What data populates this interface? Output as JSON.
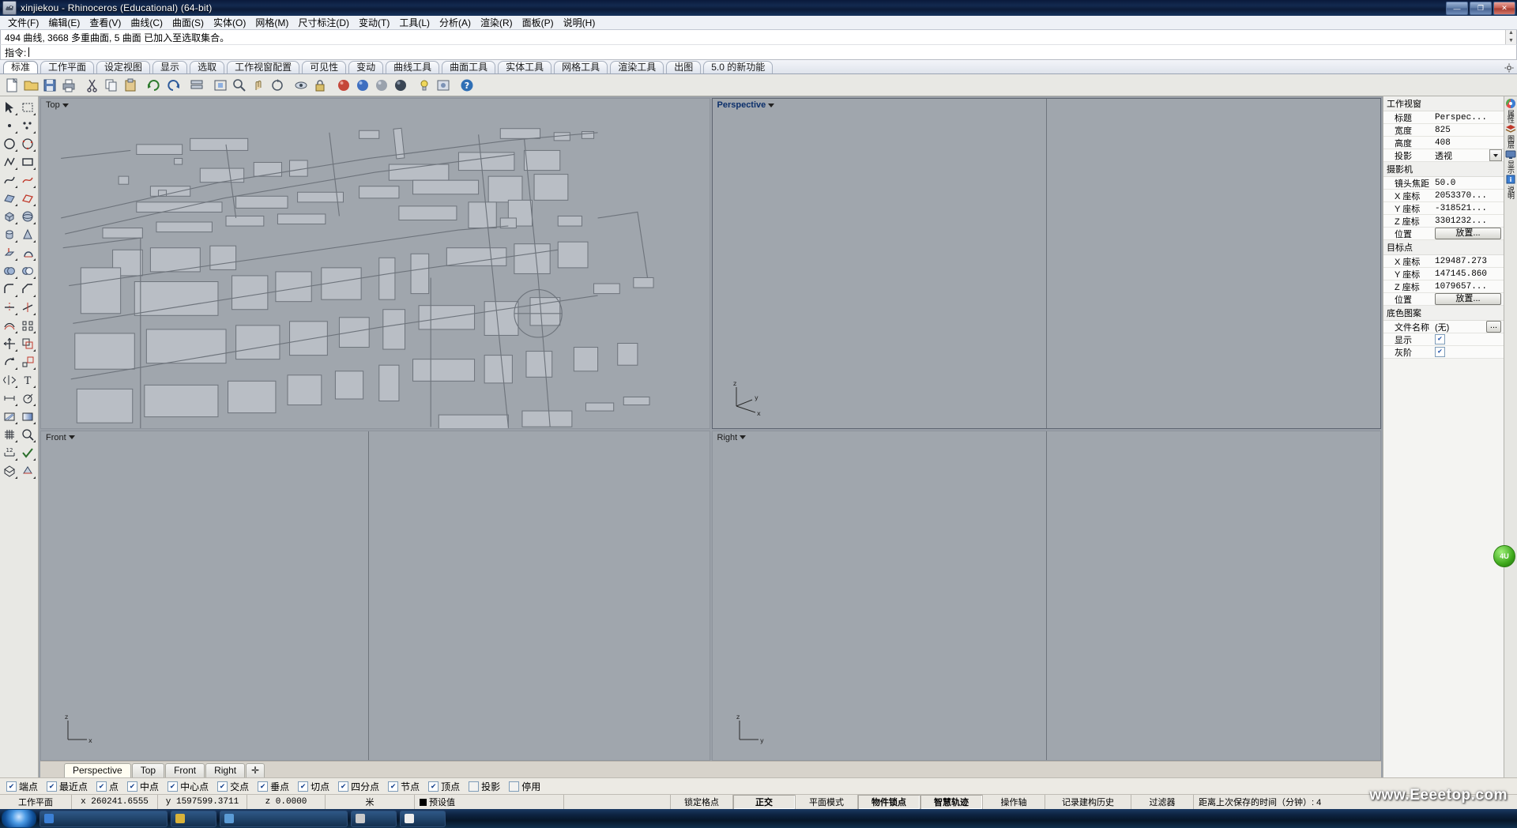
{
  "window": {
    "title": "xinjiekou - Rhinoceros (Educational) (64-bit)",
    "app_icon": "rhino-icon",
    "minimize": "—",
    "maximize": "❐",
    "close": "✕"
  },
  "menu": {
    "items": [
      {
        "label": "文件(F)",
        "name": "menu-file"
      },
      {
        "label": "编辑(E)",
        "name": "menu-edit"
      },
      {
        "label": "查看(V)",
        "name": "menu-view"
      },
      {
        "label": "曲线(C)",
        "name": "menu-curve"
      },
      {
        "label": "曲面(S)",
        "name": "menu-surface"
      },
      {
        "label": "实体(O)",
        "name": "menu-solid"
      },
      {
        "label": "网格(M)",
        "name": "menu-mesh"
      },
      {
        "label": "尺寸标注(D)",
        "name": "menu-dimension"
      },
      {
        "label": "变动(T)",
        "name": "menu-transform"
      },
      {
        "label": "工具(L)",
        "name": "menu-tools"
      },
      {
        "label": "分析(A)",
        "name": "menu-analyze"
      },
      {
        "label": "渲染(R)",
        "name": "menu-render"
      },
      {
        "label": "面板(P)",
        "name": "menu-panels"
      },
      {
        "label": "说明(H)",
        "name": "menu-help"
      }
    ]
  },
  "command": {
    "history": "494 曲线, 3668 多重曲面, 5 曲面 已加入至选取集合。",
    "prompt_label": "指令:",
    "input_value": "",
    "input_placeholder": ""
  },
  "toolbar_tabs": {
    "active": "标准",
    "items": [
      {
        "label": "标准",
        "name": "tab-standard"
      },
      {
        "label": "工作平面",
        "name": "tab-cplane"
      },
      {
        "label": "设定视图",
        "name": "tab-set-view"
      },
      {
        "label": "显示",
        "name": "tab-display"
      },
      {
        "label": "选取",
        "name": "tab-select"
      },
      {
        "label": "工作视窗配置",
        "name": "tab-viewport-layout"
      },
      {
        "label": "可见性",
        "name": "tab-visibility"
      },
      {
        "label": "变动",
        "name": "tab-transform"
      },
      {
        "label": "曲线工具",
        "name": "tab-curve-tools"
      },
      {
        "label": "曲面工具",
        "name": "tab-surface-tools"
      },
      {
        "label": "实体工具",
        "name": "tab-solid-tools"
      },
      {
        "label": "网格工具",
        "name": "tab-mesh-tools"
      },
      {
        "label": "渲染工具",
        "name": "tab-render-tools"
      },
      {
        "label": "出图",
        "name": "tab-drafting"
      },
      {
        "label": "5.0 的新功能",
        "name": "tab-whats-new"
      }
    ]
  },
  "main_toolbar": {
    "buttons": [
      {
        "name": "new-file-icon",
        "glyph": "new"
      },
      {
        "name": "open-file-icon",
        "glyph": "open"
      },
      {
        "name": "save-file-icon",
        "glyph": "save"
      },
      {
        "name": "print-icon",
        "glyph": "print"
      },
      {
        "name": "cut-icon",
        "glyph": "cut"
      },
      {
        "name": "copy-icon",
        "glyph": "copy"
      },
      {
        "name": "paste-icon",
        "glyph": "paste"
      },
      {
        "name": "undo-icon",
        "glyph": "undo"
      },
      {
        "name": "redo-icon",
        "glyph": "redo"
      },
      {
        "name": "layer-icon",
        "glyph": "layer"
      },
      {
        "name": "zoom-extents-icon",
        "glyph": "zoomext"
      },
      {
        "name": "zoom-window-icon",
        "glyph": "zoomwin"
      },
      {
        "name": "pan-icon",
        "glyph": "pan"
      },
      {
        "name": "rotate-view-icon",
        "glyph": "rotview"
      },
      {
        "name": "hide-icon",
        "glyph": "hide"
      },
      {
        "name": "lock-icon",
        "glyph": "lock"
      },
      {
        "name": "shade-red-icon",
        "glyph": "sphere-red"
      },
      {
        "name": "shade-blue-icon",
        "glyph": "sphere-blue"
      },
      {
        "name": "shade-gray-icon",
        "glyph": "sphere-gray"
      },
      {
        "name": "render-icon",
        "glyph": "sphere-dark"
      },
      {
        "name": "light-icon",
        "glyph": "light"
      },
      {
        "name": "render-props-icon",
        "glyph": "renderprops"
      },
      {
        "name": "help-icon",
        "glyph": "help"
      }
    ]
  },
  "left_tools": {
    "buttons": [
      "arrow-select-icon",
      "select-window-icon",
      "point-icon",
      "points-multi-icon",
      "circle-icon",
      "circle-3pt-icon",
      "polyline-icon",
      "rectangle-icon",
      "curve-icon",
      "freeform-icon",
      "surface-icon",
      "surface-edge-icon",
      "box-icon",
      "sphere-icon",
      "cylinder-icon",
      "cone-icon",
      "extrude-icon",
      "revolve-icon",
      "boolean-union-icon",
      "boolean-diff-icon",
      "fillet-icon",
      "chamfer-icon",
      "trim-icon",
      "split-icon",
      "offset-icon",
      "array-icon",
      "move-icon",
      "copy-move-icon",
      "rotate-icon",
      "scale-icon",
      "mirror-icon",
      "text-icon",
      "dim-linear-icon",
      "dim-radial-icon",
      "hatch-icon",
      "gradient-icon",
      "grid-icon",
      "analyze-icon",
      "measure-icon",
      "check-icon",
      "mesh-icon",
      "render-mesh-icon"
    ]
  },
  "viewports": [
    {
      "name": "viewport-top",
      "label": "Top",
      "active": false
    },
    {
      "name": "viewport-perspective",
      "label": "Perspective",
      "active": true
    },
    {
      "name": "viewport-front",
      "label": "Front",
      "active": false
    },
    {
      "name": "viewport-right",
      "label": "Right",
      "active": false
    }
  ],
  "viewport_tabs": {
    "active": "Perspective",
    "items": [
      {
        "label": "Perspective",
        "name": "vptab-perspective"
      },
      {
        "label": "Top",
        "name": "vptab-top"
      },
      {
        "label": "Front",
        "name": "vptab-front"
      },
      {
        "label": "Right",
        "name": "vptab-right"
      },
      {
        "label": "✛",
        "name": "vptab-add"
      }
    ]
  },
  "properties": {
    "sections": [
      {
        "title": "工作视窗",
        "name": "section-viewport",
        "rows": [
          {
            "label": "标题",
            "value": "Perspec...",
            "type": "text",
            "name": "prop-title"
          },
          {
            "label": "宽度",
            "value": "825",
            "type": "text",
            "name": "prop-width"
          },
          {
            "label": "高度",
            "value": "408",
            "type": "text",
            "name": "prop-height"
          },
          {
            "label": "投影",
            "value": "透视",
            "type": "combo",
            "name": "prop-projection"
          }
        ]
      },
      {
        "title": "摄影机",
        "name": "section-camera",
        "rows": [
          {
            "label": "镜头焦距",
            "value": "50.0",
            "type": "text",
            "name": "prop-lens-length"
          },
          {
            "label": "X 座标",
            "value": "2053370...",
            "type": "text",
            "name": "prop-cam-x"
          },
          {
            "label": "Y 座标",
            "value": "-318521...",
            "type": "text",
            "name": "prop-cam-y"
          },
          {
            "label": "Z 座标",
            "value": "3301232...",
            "type": "text",
            "name": "prop-cam-z"
          },
          {
            "label": "位置",
            "value": "放置...",
            "type": "button",
            "name": "prop-cam-place"
          }
        ]
      },
      {
        "title": "目标点",
        "name": "section-target",
        "rows": [
          {
            "label": "X 座标",
            "value": "129487.273",
            "type": "text",
            "name": "prop-tgt-x"
          },
          {
            "label": "Y 座标",
            "value": "147145.860",
            "type": "text",
            "name": "prop-tgt-y"
          },
          {
            "label": "Z 座标",
            "value": "1079657...",
            "type": "text",
            "name": "prop-tgt-z"
          },
          {
            "label": "位置",
            "value": "放置...",
            "type": "button",
            "name": "prop-tgt-place"
          }
        ]
      },
      {
        "title": "底色图案",
        "name": "section-wallpaper",
        "rows": [
          {
            "label": "文件名称",
            "value": "(无)",
            "type": "file",
            "name": "prop-wallpaper-file"
          },
          {
            "label": "显示",
            "value": "",
            "type": "check",
            "checked": true,
            "name": "prop-wallpaper-show"
          },
          {
            "label": "灰阶",
            "value": "",
            "type": "check",
            "checked": true,
            "name": "prop-wallpaper-gray"
          }
        ]
      }
    ]
  },
  "right_strip": {
    "items": [
      {
        "icon": "color-wheel-icon",
        "label": "属性",
        "name": "panel-properties"
      },
      {
        "icon": "layers-icon",
        "label": "图层",
        "name": "panel-layers"
      },
      {
        "icon": "display-icon",
        "label": "显示",
        "name": "panel-display"
      },
      {
        "icon": "help-book-icon",
        "label": "说明",
        "name": "panel-help"
      }
    ]
  },
  "osnap": {
    "items": [
      {
        "label": "端点",
        "checked": true,
        "name": "osnap-end"
      },
      {
        "label": "最近点",
        "checked": true,
        "name": "osnap-near"
      },
      {
        "label": "点",
        "checked": true,
        "name": "osnap-point"
      },
      {
        "label": "中点",
        "checked": true,
        "name": "osnap-mid"
      },
      {
        "label": "中心点",
        "checked": true,
        "name": "osnap-center"
      },
      {
        "label": "交点",
        "checked": true,
        "name": "osnap-int"
      },
      {
        "label": "垂点",
        "checked": true,
        "name": "osnap-perp"
      },
      {
        "label": "切点",
        "checked": true,
        "name": "osnap-tan"
      },
      {
        "label": "四分点",
        "checked": true,
        "name": "osnap-quad"
      },
      {
        "label": "节点",
        "checked": true,
        "name": "osnap-knot"
      },
      {
        "label": "顶点",
        "checked": true,
        "name": "osnap-vertex"
      },
      {
        "label": "投影",
        "checked": false,
        "name": "osnap-project"
      },
      {
        "label": "停用",
        "checked": false,
        "name": "osnap-disable"
      }
    ]
  },
  "statusbar": {
    "cplane_label": "工作平面",
    "coord_x": "x 260241.6555",
    "coord_y": "y 1597599.3711",
    "coord_z": "z 0.0000",
    "units": "米",
    "layer_name": "预设值",
    "layer_color": "#000000",
    "toggles": [
      {
        "label": "锁定格点",
        "bold": false,
        "name": "status-grid-snap"
      },
      {
        "label": "正交",
        "bold": true,
        "name": "status-ortho"
      },
      {
        "label": "平面模式",
        "bold": false,
        "name": "status-planar"
      },
      {
        "label": "物件锁点",
        "bold": true,
        "name": "status-osnap"
      },
      {
        "label": "智慧轨迹",
        "bold": true,
        "name": "status-smarttrack"
      },
      {
        "label": "操作轴",
        "bold": false,
        "name": "status-gumball"
      },
      {
        "label": "记录建构历史",
        "bold": false,
        "name": "status-record-history"
      },
      {
        "label": "过滤器",
        "bold": false,
        "name": "status-filter"
      }
    ],
    "autosave": "距离上次保存的时间（分钟）: 4"
  },
  "taskbar": {
    "items": [
      {
        "label": "",
        "name": "taskbar-item-1",
        "color": "#3b7fd4"
      },
      {
        "label": "",
        "name": "taskbar-item-2",
        "color": "#d8b23a"
      },
      {
        "label": "",
        "name": "taskbar-item-3",
        "color": "#5b9bd5"
      },
      {
        "label": "",
        "name": "taskbar-item-4",
        "color": "#c0c0c0"
      },
      {
        "label": "",
        "name": "taskbar-item-5",
        "color": "#e8e8e8"
      }
    ],
    "clock": ""
  },
  "watermark": "www.Eeeetop.com",
  "float_button": "4U"
}
